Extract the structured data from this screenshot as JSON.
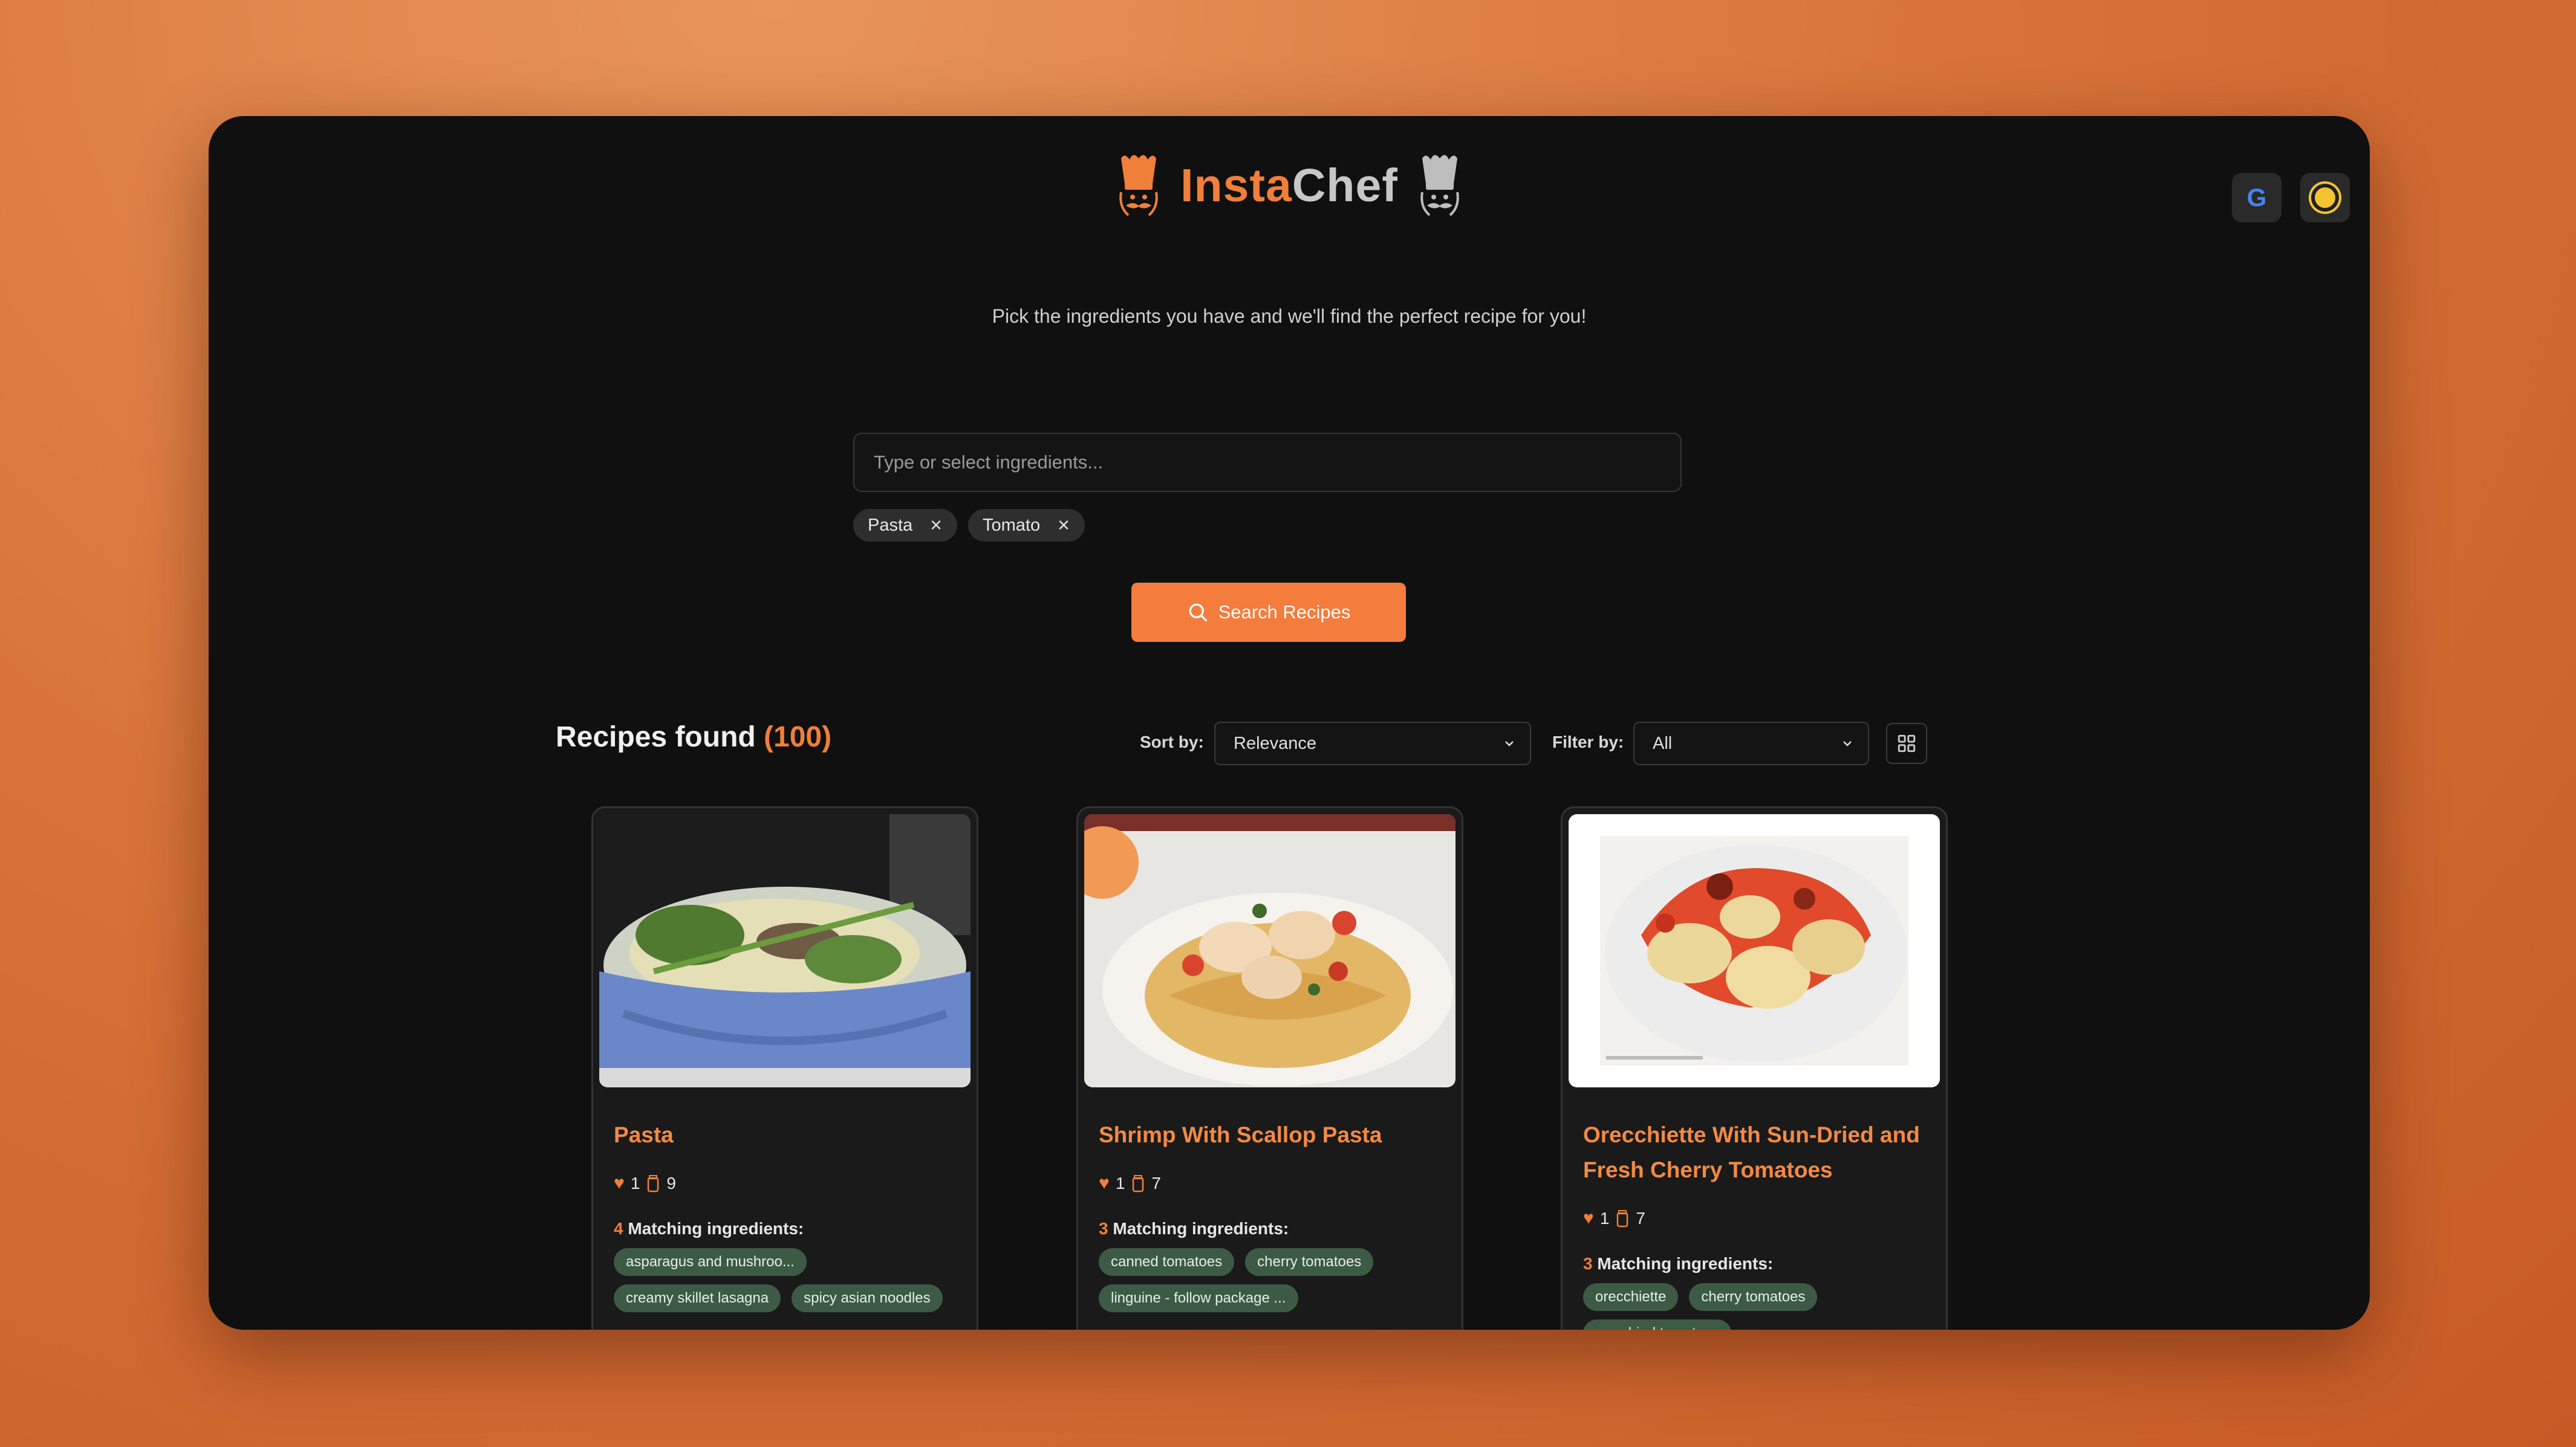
{
  "header": {
    "brand_part1": "Insta",
    "brand_part2": "Chef",
    "google_label": "G"
  },
  "tagline": "Pick the ingredients you have and we'll find the perfect recipe for you!",
  "search": {
    "placeholder": "Type or select ingredients...",
    "chips": [
      "Pasta",
      "Tomato"
    ],
    "button_label": "Search Recipes"
  },
  "results": {
    "title": "Recipes found",
    "count": "(100)",
    "sort_label": "Sort by:",
    "sort_value": "Relevance",
    "filter_label": "Filter by:",
    "filter_value": "All"
  },
  "recipes": [
    {
      "title": "Pasta",
      "likes": "1",
      "ingredients": "9",
      "match_count": "4",
      "match_label": "Matching ingredients:",
      "tags": [
        "asparagus and mushroo...",
        "creamy skillet lasagna",
        "spicy asian noodles"
      ]
    },
    {
      "title": "Shrimp With Scallop Pasta",
      "likes": "1",
      "ingredients": "7",
      "match_count": "3",
      "match_label": "Matching ingredients:",
      "tags": [
        "canned tomatoes",
        "cherry tomatoes",
        "linguine - follow package ..."
      ]
    },
    {
      "title": "Orecchiette With Sun-Dried and Fresh Cherry Tomatoes",
      "likes": "1",
      "ingredients": "7",
      "match_count": "3",
      "match_label": "Matching ingredients:",
      "tags": [
        "orecchiette",
        "cherry tomatoes",
        "sun-dried tomatoes"
      ]
    }
  ],
  "colors": {
    "accent": "#f47c3c",
    "tag_bg": "#3c5a44",
    "window_bg": "#101010"
  }
}
